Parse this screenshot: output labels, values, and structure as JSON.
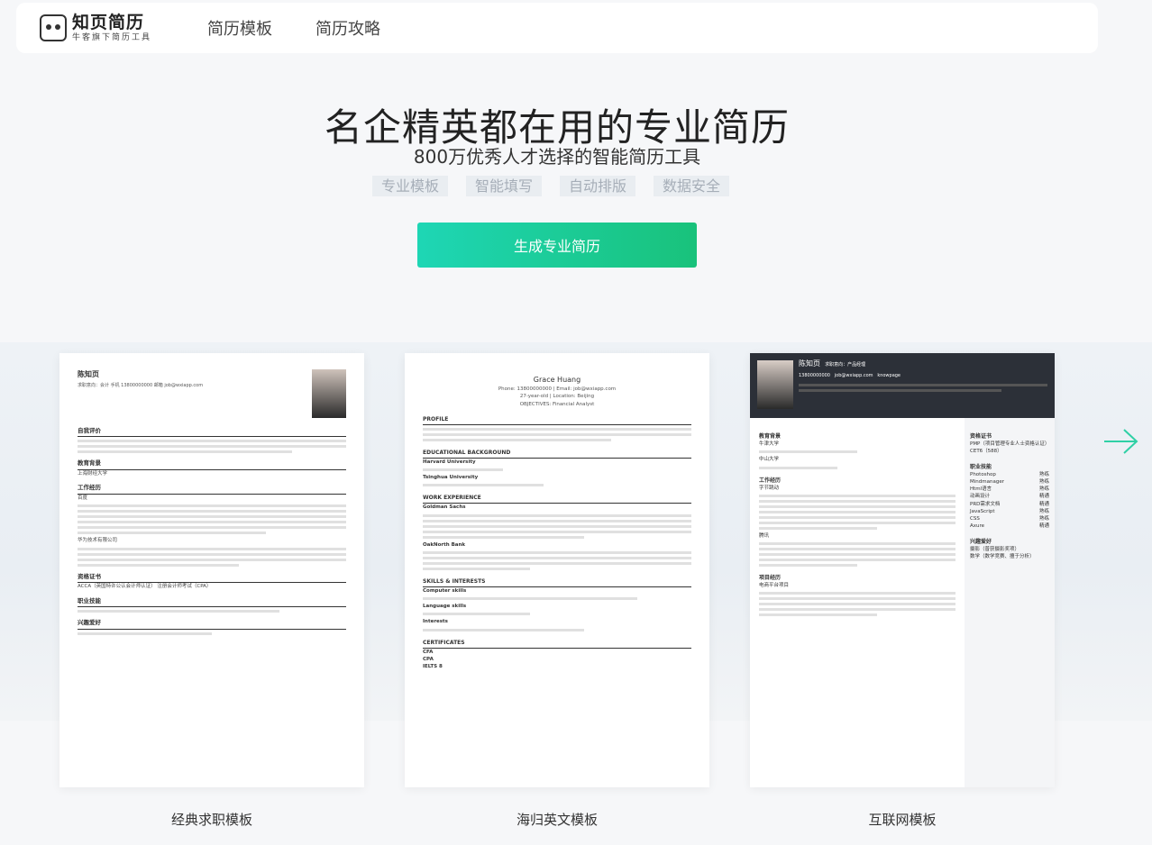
{
  "nav": {
    "logo_main": "知页简历",
    "logo_sub": "牛客旗下简历工具",
    "links": [
      "简历模板",
      "简历攻略"
    ]
  },
  "hero": {
    "title": "名企精英都在用的专业简历",
    "subtitle": "800万优秀人才选择的智能简历工具",
    "tags": [
      "专业模板",
      "智能填写",
      "自动排版",
      "数据安全"
    ],
    "cta": "生成专业简历"
  },
  "templates": [
    {
      "label": "经典求职模板",
      "name": "陈知页",
      "meta": "求职意向：会计   手机 13800000000   邮箱 job@wxiapp.com",
      "sections": [
        "自我评价",
        "教育背景",
        "工作经历",
        "资格证书",
        "职业技能",
        "兴趣爱好"
      ],
      "school": "上海财经大学",
      "jobs": [
        "百度",
        "华为技术有限公司"
      ],
      "cert": "ACCA（英国特许公认会计师认证）   注册会计师考试（CPA）"
    },
    {
      "label": "海归英文模板",
      "name": "Grace Huang",
      "contact": "Phone: 13800000000 | Email: job@wxiapp.com",
      "meta": "27-year-old | Location: Beijing",
      "objective": "OBJECTIVES: Financial Analyst",
      "sections": [
        "PROFILE",
        "EDUCATIONAL BACKGROUND",
        "WORK EXPERIENCE",
        "SKILLS & INTERESTS",
        "CERTIFICATES"
      ],
      "schools": [
        "Harvard University",
        "Tsinghua University"
      ],
      "companies": [
        "Goldman Sachs",
        "OakNorth Bank"
      ],
      "skills": [
        "Computer skills",
        "Language skills",
        "Interests"
      ],
      "certs": [
        "CFA",
        "CPA",
        "IELTS 8"
      ]
    },
    {
      "label": "互联网模板",
      "name": "陈知页",
      "intent": "求职意向：产品经理",
      "phone": "13800000000",
      "email": "job@wxiapp.com",
      "site": "knowpage",
      "left_sections": [
        "教育背景",
        "工作经历",
        "项目经历"
      ],
      "right_sections": [
        "资格证书",
        "职业技能",
        "兴趣爱好"
      ],
      "schools": [
        "牛津大学",
        "中山大学"
      ],
      "jobs": [
        "字节跳动",
        "腾讯"
      ],
      "project": "电商平台项目",
      "certs": [
        "PMP（项目管理专业人士资格认证）",
        "CET6（588）"
      ],
      "skills": [
        {
          "name": "Photoshop",
          "level": "熟练"
        },
        {
          "name": "Mindmanager",
          "level": "熟练"
        },
        {
          "name": "Html语言",
          "level": "熟练"
        },
        {
          "name": "动画设计",
          "level": "精通"
        },
        {
          "name": "PRD需求文档",
          "level": "精通"
        },
        {
          "name": "JavaScript",
          "level": "熟练"
        },
        {
          "name": "CSS",
          "level": "熟练"
        },
        {
          "name": "Axure",
          "level": "精通"
        }
      ],
      "hobbies": [
        "摄影（普获摄影奖项）",
        "数学（数学竞赛、擅于分析）"
      ]
    }
  ]
}
